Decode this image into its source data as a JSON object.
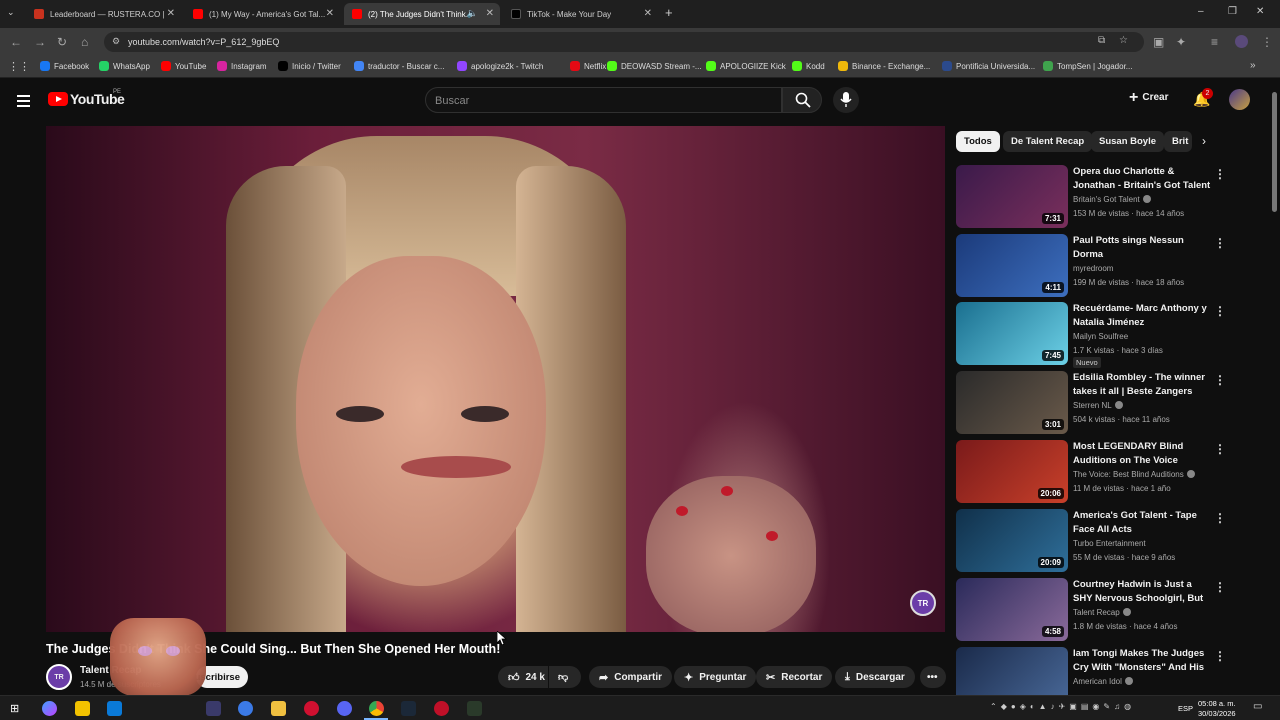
{
  "browser": {
    "tabs": [
      {
        "title": "Leaderboard — RUSTERA.CO |",
        "favicon_color": "#c8321e",
        "active": false
      },
      {
        "title": "(1) My Way - America's Got Tal...",
        "favicon_color": "#ff0000",
        "active": false
      },
      {
        "title": "(2) The Judges Didn't Think...",
        "favicon_color": "#ff0000",
        "active": true
      },
      {
        "title": "TikTok - Make Your Day",
        "favicon_color": "#000000",
        "active": false
      }
    ],
    "new_tab_glyph": "+",
    "url": "youtube.com/watch?v=P_612_9gbEQ",
    "window_controls": [
      "–",
      "❐",
      "✕"
    ],
    "bookmarks": [
      {
        "label": "Facebook",
        "color": "#1877f2"
      },
      {
        "label": "WhatsApp",
        "color": "#25d366"
      },
      {
        "label": "YouTube",
        "color": "#ff0000"
      },
      {
        "label": "Instagram",
        "color": "#d6249f"
      },
      {
        "label": "Inicio / Twitter",
        "color": "#000000"
      },
      {
        "label": "traductor - Buscar c...",
        "color": "#4285f4"
      },
      {
        "label": "apologize2k - Twitch",
        "color": "#9146ff"
      },
      {
        "label": "Netflix",
        "color": "#e50914"
      },
      {
        "label": "DEOWASD Stream -...",
        "color": "#53fc18"
      },
      {
        "label": "APOLOGIIZE Kick",
        "color": "#53fc18"
      },
      {
        "label": "Kodd",
        "color": "#53fc18"
      },
      {
        "label": "Binance - Exchange...",
        "color": "#f0b90b"
      },
      {
        "label": "Pontificia Universida...",
        "color": "#2b4a8c"
      },
      {
        "label": "TompSen | Jogador...",
        "color": "#3fa34d"
      }
    ]
  },
  "youtube": {
    "logo_text": "YouTube",
    "region": "PE",
    "search_placeholder": "Buscar",
    "create_label": "Crear",
    "notification_count": "2"
  },
  "video": {
    "title": "The Judges Didn't Think She Could Sing... But Then She Opened Her Mouth!",
    "watermark": "TR",
    "channel_name": "Talent Recap",
    "subscribers": "14.5 M de suscriptores",
    "subscribe_label": "Suscribirse",
    "likes": "24 k",
    "share_label": "Compartir",
    "ask_label": "Preguntar",
    "clip_label": "Recortar",
    "download_label": "Descargar"
  },
  "chips": [
    "Todos",
    "De Talent Recap",
    "Susan Boyle",
    "Brit"
  ],
  "recommendations": [
    {
      "title": "Opera duo Charlotte & Jonathan - Britain's Got Talent 2012 ...",
      "channel": "Britain's Got Talent",
      "verified": true,
      "meta": "153 M de vistas · hace 14 años",
      "duration": "7:31",
      "thumb": [
        "#3a1a4a",
        "#7a2f5c"
      ],
      "badge": ""
    },
    {
      "title": "Paul Potts sings Nessun Dorma",
      "channel": "myredroom",
      "verified": false,
      "meta": "199 M de vistas · hace 18 años",
      "duration": "4:11",
      "thumb": [
        "#1b3a7a",
        "#3d6fbf"
      ],
      "badge": ""
    },
    {
      "title": "Recuérdame- Marc Anthony y Natalia Jiménez",
      "channel": "Mailyn Soulfree",
      "verified": false,
      "meta": "1.7 K vistas · hace 3 días",
      "duration": "7:45",
      "thumb": [
        "#1a6f8f",
        "#6cd0e6"
      ],
      "badge": "Nuevo"
    },
    {
      "title": "Edsilia Rombley - The winner takes it all | Beste Zangers 2014",
      "channel": "Sterren NL",
      "verified": true,
      "meta": "504 k vistas · hace 11 años",
      "duration": "3:01",
      "thumb": [
        "#2a2a2a",
        "#6a5a4a"
      ],
      "badge": ""
    },
    {
      "title": "Most LEGENDARY Blind Auditions on The Voice",
      "channel": "The Voice: Best Blind Auditions",
      "verified": true,
      "meta": "11 M de vistas · hace 1 año",
      "duration": "20:06",
      "thumb": [
        "#7a1a1a",
        "#c8402a"
      ],
      "badge": ""
    },
    {
      "title": "America's Got Talent - Tape Face All Acts",
      "channel": "Turbo Entertainment",
      "verified": false,
      "meta": "55 M de vistas · hace 9 años",
      "duration": "20:09",
      "thumb": [
        "#10304a",
        "#2f6f9a"
      ],
      "badge": ""
    },
    {
      "title": "Courtney Hadwin is Just a SHY Nervous Schoolgirl, But Watch...",
      "channel": "Talent Recap",
      "verified": true,
      "meta": "1.8 M de vistas · hace 4 años",
      "duration": "4:58",
      "thumb": [
        "#2a2a5a",
        "#8a6a9a"
      ],
      "badge": ""
    },
    {
      "title": "Iam Tongi Makes The Judges Cry With \"Monsters\" And His ...",
      "channel": "American Idol",
      "verified": true,
      "meta": "",
      "duration": "",
      "thumb": [
        "#1a2a4a",
        "#4a6a9a"
      ],
      "badge": ""
    }
  ],
  "taskbar": {
    "lang": "ESP",
    "time": "05:08 a. m.",
    "date": "30/03/2026"
  }
}
